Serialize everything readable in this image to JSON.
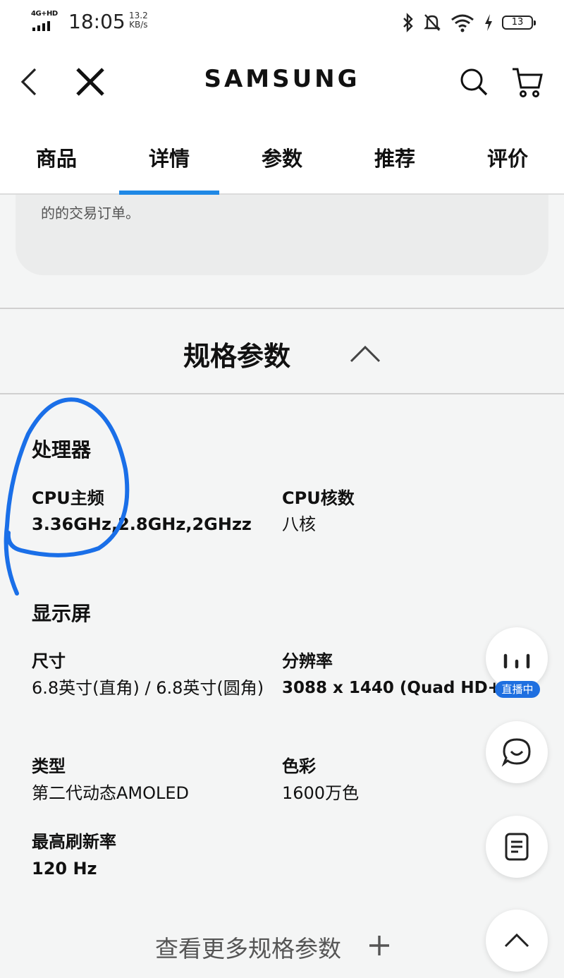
{
  "status_bar": {
    "network": "4G+HD",
    "time": "18:05",
    "speed_value": "13.2",
    "speed_unit": "KB/s",
    "battery": "13",
    "icons": [
      "bluetooth-icon",
      "mute-icon",
      "wifi-icon",
      "charging-icon",
      "battery-icon"
    ]
  },
  "navbar": {
    "brand": "SAMSUNG",
    "icons": [
      "back-icon",
      "close-icon",
      "search-icon",
      "cart-icon"
    ]
  },
  "tabs": [
    {
      "label": "商品",
      "active": false
    },
    {
      "label": "详情",
      "active": true
    },
    {
      "label": "参数",
      "active": false
    },
    {
      "label": "推荐",
      "active": false
    },
    {
      "label": "评价",
      "active": false
    }
  ],
  "accent_color": "#1f88e5",
  "note": {
    "text": "的的交易订单。"
  },
  "specs": {
    "title": "规格参数",
    "processor": {
      "title": "处理器",
      "cpu_freq_label": "CPU主频",
      "cpu_freq_value": "3.36GHz,2.8GHz,2GHzz",
      "cpu_cores_label": "CPU核数",
      "cpu_cores_value": "八核"
    },
    "display": {
      "title": "显示屏",
      "size_label": "尺寸",
      "size_value": "6.8英寸(直角) / 6.8英寸(圆角)",
      "resolution_label": "分辨率",
      "resolution_value": "3088 x 1440 (Quad HD+)",
      "type_label": "类型",
      "type_value": "第二代动态AMOLED",
      "color_label": "色彩",
      "color_value": "1600万色",
      "refresh_label": "最高刷新率",
      "refresh_value": "120 Hz"
    },
    "more_label": "查看更多规格参数"
  },
  "floating": {
    "live_badge": "直播中",
    "icons": [
      "live-bars-icon",
      "chat-icon",
      "document-icon",
      "chevron-up-icon"
    ]
  },
  "annotation_color": "#1a6fe8"
}
